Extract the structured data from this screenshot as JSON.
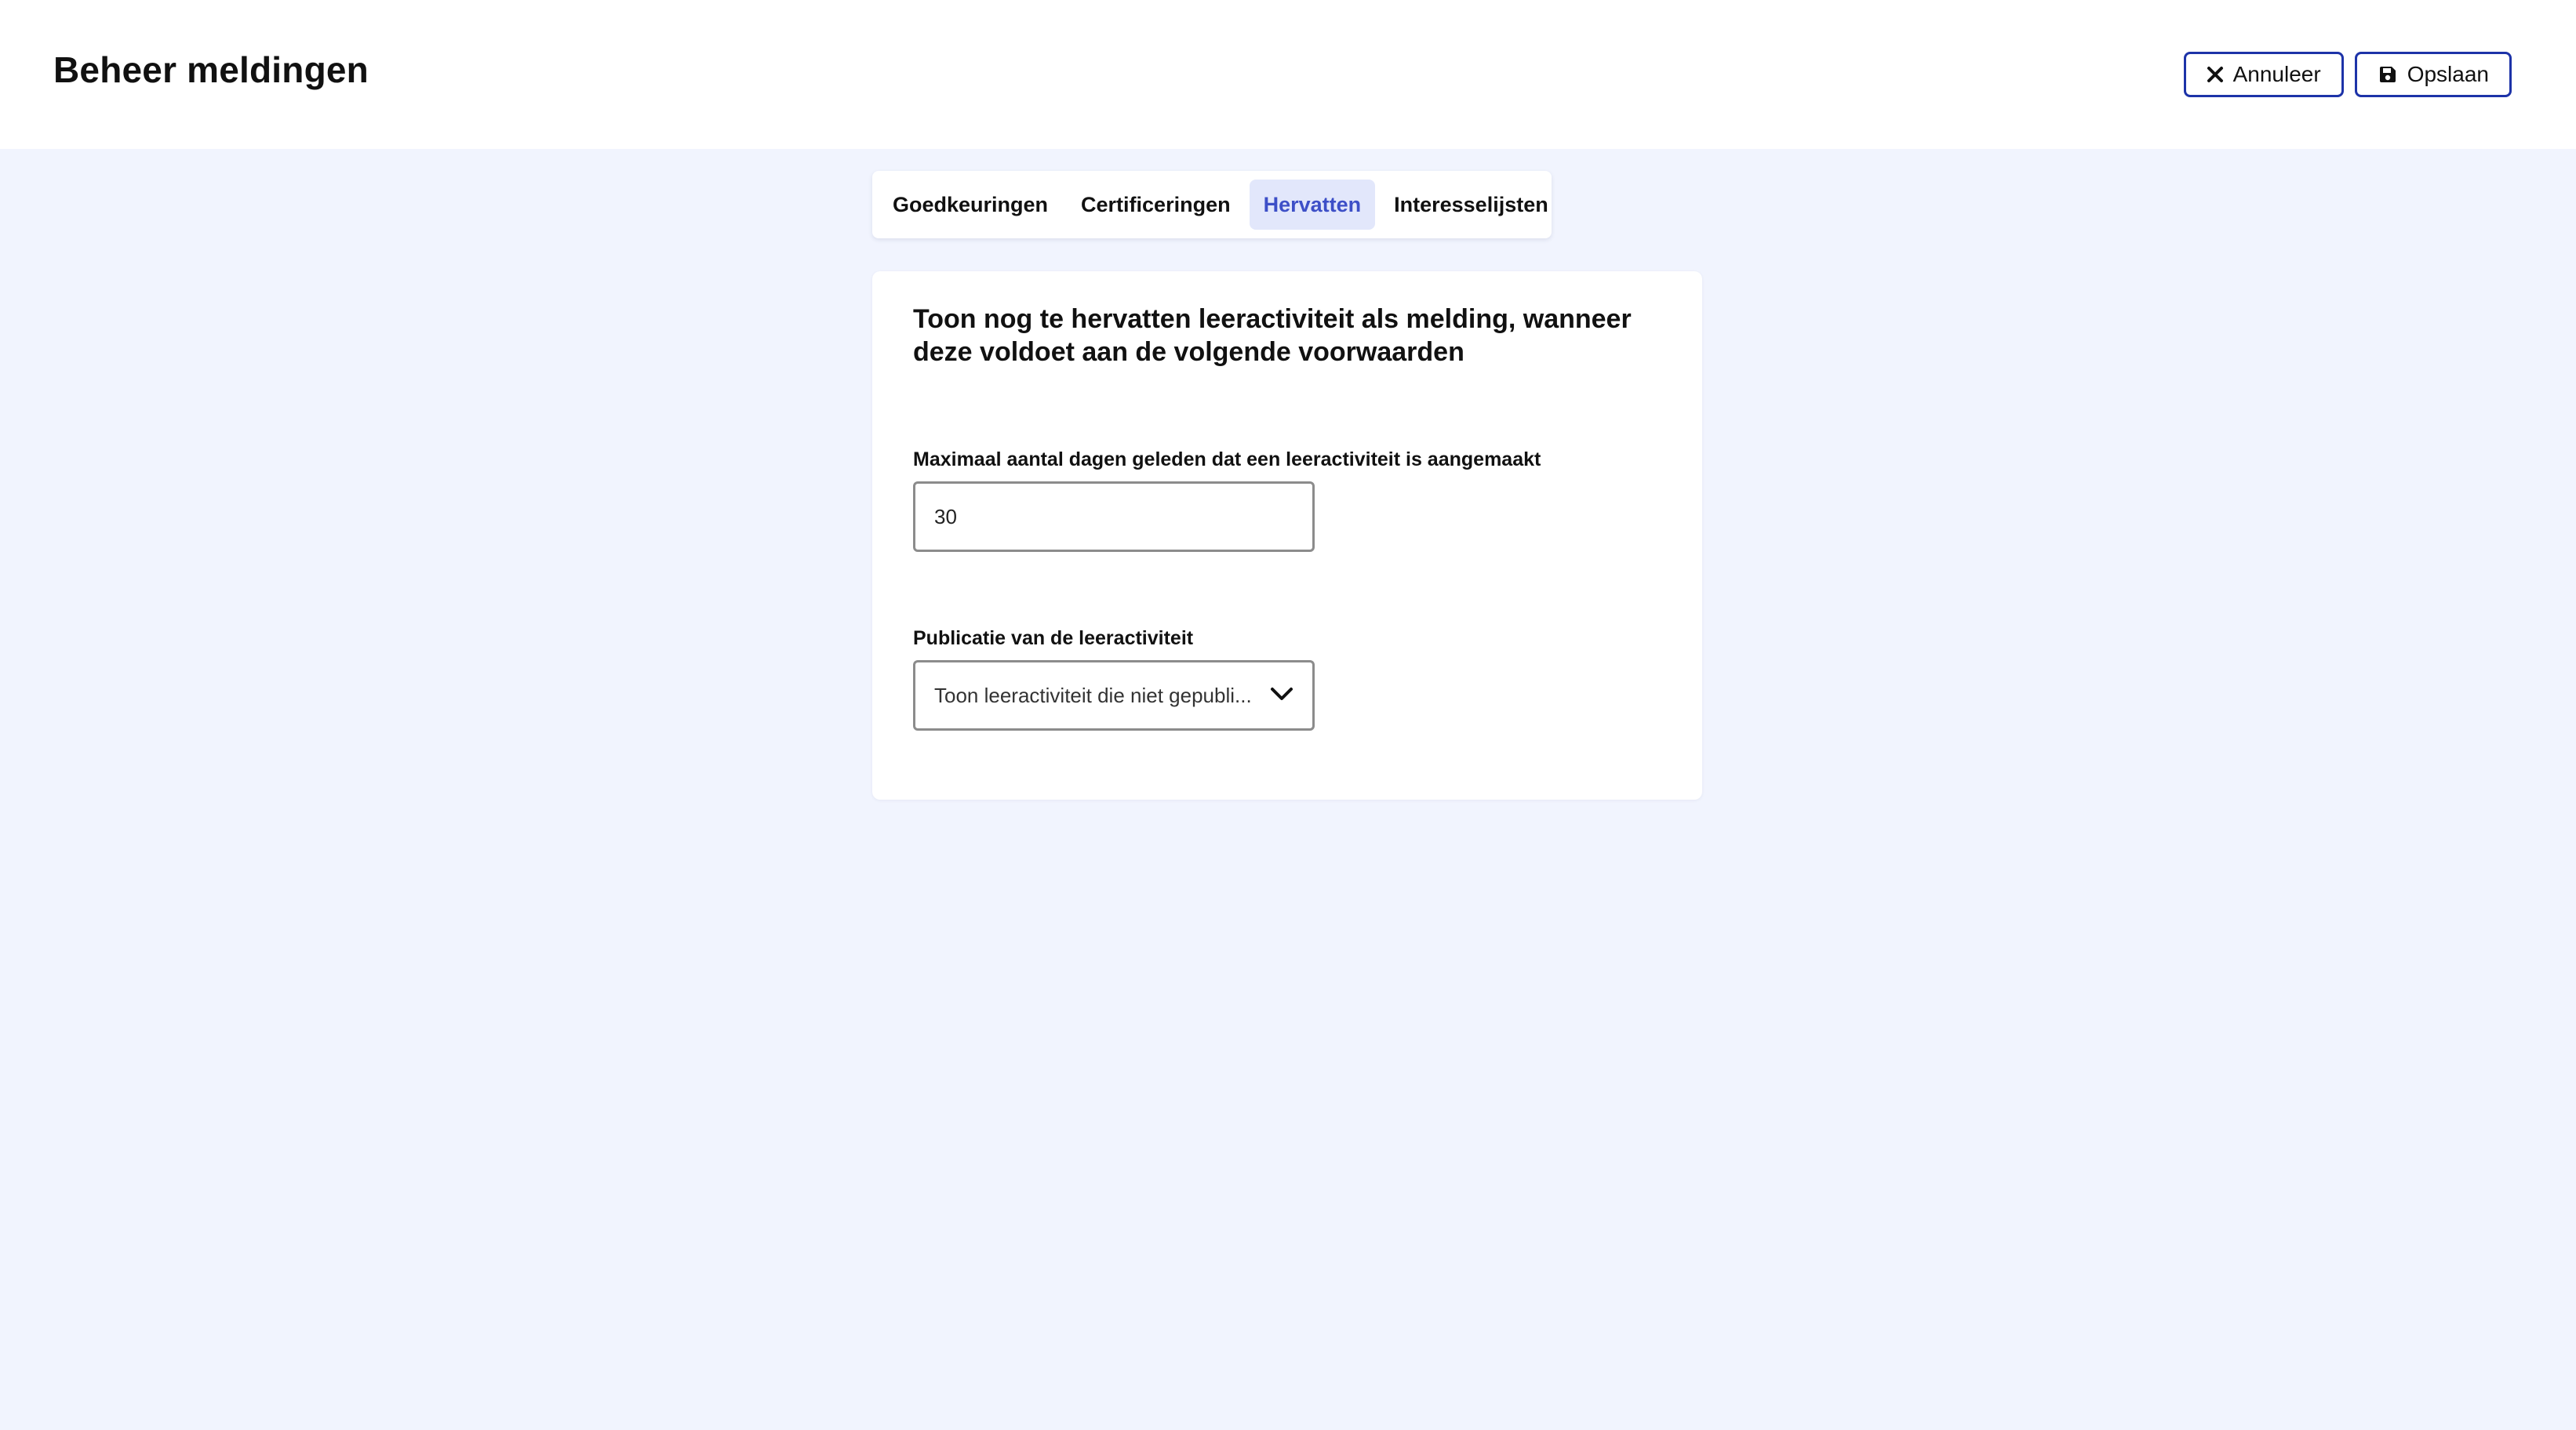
{
  "header": {
    "title": "Beheer meldingen",
    "cancel_label": "Annuleer",
    "save_label": "Opslaan"
  },
  "tabs": [
    {
      "label": "Goedkeuringen",
      "active": false
    },
    {
      "label": "Certificeringen",
      "active": false
    },
    {
      "label": "Hervatten",
      "active": true
    },
    {
      "label": "Interesselijsten",
      "active": false
    }
  ],
  "form": {
    "title": "Toon nog te hervatten leeractiviteit als melding, wanneer deze voldoet aan de volgende voorwaarden",
    "max_days": {
      "label": "Maximaal aantal dagen geleden dat een leeractiviteit is aangemaakt",
      "value": "30"
    },
    "publication": {
      "label": "Publicatie van de leeractiviteit",
      "selected": "Toon leeractiviteit die niet gepubli..."
    }
  },
  "icons": {
    "cancel": "close-icon",
    "save": "save-icon",
    "dropdown": "chevron-down-icon"
  },
  "colors": {
    "background": "#f1f4fe",
    "accent": "#1d33a8",
    "active_tab_bg": "#e2e7fb",
    "active_tab_text": "#3d4fc7"
  }
}
